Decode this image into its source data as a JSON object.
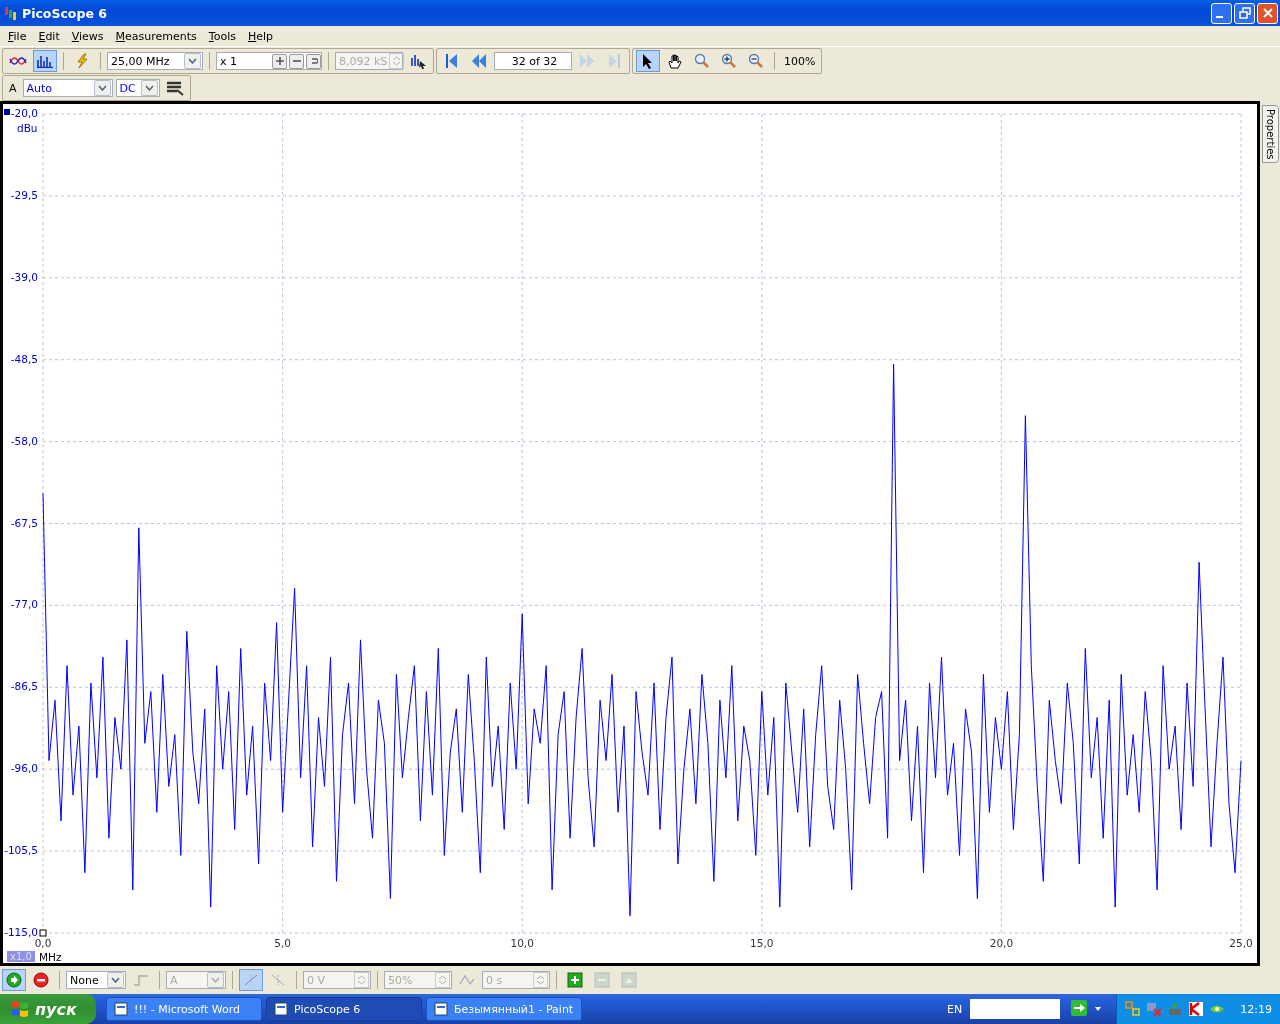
{
  "window": {
    "title": "PicoScope 6"
  },
  "menu": [
    {
      "label": "File"
    },
    {
      "label": "Edit"
    },
    {
      "label": "Views"
    },
    {
      "label": "Measurements"
    },
    {
      "label": "Tools"
    },
    {
      "label": "Help"
    }
  ],
  "toolbar": {
    "modes": [
      {
        "kind": "scope",
        "selected": false
      },
      {
        "kind": "spectrum",
        "selected": true
      }
    ],
    "timebase": "25,00 MHz",
    "zoom": "x 1",
    "samples": "8,092 kS",
    "samples_disabled": true,
    "buffer": "32 of 32",
    "tools": [
      {
        "kind": "pointer",
        "selected": true
      },
      {
        "kind": "hand",
        "selected": false
      },
      {
        "kind": "zoom",
        "selected": false
      },
      {
        "kind": "zoom-in",
        "selected": false
      },
      {
        "kind": "zoom-out",
        "selected": false
      }
    ],
    "zoom_percent": "100%"
  },
  "channel": {
    "name": "A",
    "range": "Auto",
    "coupling": "DC"
  },
  "chart": {
    "y_unit": "dBu",
    "x_unit": "MHz",
    "x_scale": "x1,0",
    "chart_data": {
      "type": "line",
      "xlim": [
        0,
        25
      ],
      "ylim": [
        -115,
        -20
      ],
      "xticks": [
        {
          "value": 0,
          "label": "0,0"
        },
        {
          "value": 5,
          "label": "5,0"
        },
        {
          "value": 10,
          "label": "10,0"
        },
        {
          "value": 15,
          "label": "15,0"
        },
        {
          "value": 20,
          "label": "20,0"
        },
        {
          "value": 25,
          "label": "25,0"
        }
      ],
      "yticks": [
        {
          "value": -20,
          "label": "-20,0"
        },
        {
          "value": -29.5,
          "label": "-29,5"
        },
        {
          "value": -39,
          "label": "-39,0"
        },
        {
          "value": -48.5,
          "label": "-48,5"
        },
        {
          "value": -58,
          "label": "-58,0"
        },
        {
          "value": -67.5,
          "label": "-67,5"
        },
        {
          "value": -77,
          "label": "-77,0"
        },
        {
          "value": -86.5,
          "label": "-86,5"
        },
        {
          "value": -96,
          "label": "-96,0"
        },
        {
          "value": -105.5,
          "label": "-105,5"
        },
        {
          "value": -115,
          "label": "-115,0"
        }
      ],
      "grid": true,
      "x": [
        0,
        0.125,
        0.25,
        0.375,
        0.5,
        0.625,
        0.75,
        0.875,
        1,
        1.125,
        1.25,
        1.375,
        1.5,
        1.625,
        1.75,
        1.875,
        2,
        2.125,
        2.25,
        2.375,
        2.5,
        2.625,
        2.75,
        2.875,
        3,
        3.125,
        3.25,
        3.375,
        3.5,
        3.625,
        3.75,
        3.875,
        4,
        4.125,
        4.25,
        4.375,
        4.5,
        4.625,
        4.75,
        4.875,
        5,
        5.125,
        5.25,
        5.375,
        5.5,
        5.625,
        5.75,
        5.875,
        6,
        6.125,
        6.25,
        6.375,
        6.5,
        6.625,
        6.75,
        6.875,
        7,
        7.125,
        7.25,
        7.375,
        7.5,
        7.625,
        7.75,
        7.875,
        8,
        8.125,
        8.25,
        8.375,
        8.5,
        8.625,
        8.75,
        8.875,
        9,
        9.125,
        9.25,
        9.375,
        9.5,
        9.625,
        9.75,
        9.875,
        10,
        10.125,
        10.25,
        10.375,
        10.5,
        10.625,
        10.75,
        10.875,
        11,
        11.125,
        11.25,
        11.375,
        11.5,
        11.625,
        11.75,
        11.875,
        12,
        12.125,
        12.25,
        12.375,
        12.5,
        12.625,
        12.75,
        12.875,
        13,
        13.125,
        13.25,
        13.375,
        13.5,
        13.625,
        13.75,
        13.875,
        14,
        14.125,
        14.25,
        14.375,
        14.5,
        14.625,
        14.75,
        14.875,
        15,
        15.125,
        15.25,
        15.375,
        15.5,
        15.625,
        15.75,
        15.875,
        16,
        16.125,
        16.25,
        16.375,
        16.5,
        16.625,
        16.75,
        16.875,
        17,
        17.125,
        17.25,
        17.375,
        17.5,
        17.625,
        17.75,
        17.875,
        18,
        18.125,
        18.25,
        18.375,
        18.5,
        18.625,
        18.75,
        18.875,
        19,
        19.125,
        19.25,
        19.375,
        19.5,
        19.625,
        19.75,
        19.875,
        20,
        20.125,
        20.25,
        20.375,
        20.5,
        20.625,
        20.75,
        20.875,
        21,
        21.125,
        21.25,
        21.375,
        21.5,
        21.625,
        21.75,
        21.875,
        22,
        22.125,
        22.25,
        22.375,
        22.5,
        22.625,
        22.75,
        22.875,
        23,
        23.125,
        23.25,
        23.375,
        23.5,
        23.625,
        23.75,
        23.875,
        24,
        24.125,
        24.25,
        24.375,
        24.5,
        24.625,
        24.75,
        24.875,
        25
      ],
      "series": [
        {
          "color": "#0000ff",
          "values": [
            -64,
            -95,
            -88,
            -102,
            -84,
            -99,
            -91,
            -108,
            -86,
            -97,
            -83,
            -104,
            -90,
            -96,
            -81,
            -110,
            -68,
            -93,
            -87,
            -101,
            -85,
            -98,
            -92,
            -106,
            -80,
            -94,
            -100,
            -89,
            -112,
            -84,
            -96,
            -87,
            -103,
            -82,
            -99,
            -91,
            -107,
            -86,
            -95,
            -79,
            -101,
            -88,
            -75,
            -97,
            -84,
            -105,
            -90,
            -98,
            -83,
            -109,
            -92,
            -86,
            -100,
            -81,
            -96,
            -104,
            -88,
            -93,
            -111,
            -85,
            -97,
            -90,
            -84,
            -102,
            -87,
            -99,
            -82,
            -106,
            -94,
            -89,
            -101,
            -85,
            -95,
            -108,
            -83,
            -98,
            -91,
            -103,
            -86,
            -96,
            -78,
            -100,
            -89,
            -93,
            -84,
            -110,
            -92,
            -87,
            -104,
            -90,
            -82,
            -97,
            -105,
            -88,
            -95,
            -85,
            -101,
            -91,
            -113,
            -87,
            -94,
            -99,
            -86,
            -103,
            -90,
            -83,
            -107,
            -96,
            -89,
            -100,
            -85,
            -93,
            -109,
            -88,
            -97,
            -84,
            -102,
            -91,
            -95,
            -106,
            -87,
            -99,
            -90,
            -112,
            -86,
            -94,
            -101,
            -89,
            -105,
            -92,
            -84,
            -98,
            -103,
            -88,
            -96,
            -110,
            -85,
            -93,
            -100,
            -90,
            -87,
            -104,
            -49,
            -95,
            -88,
            -102,
            -91,
            -108,
            -86,
            -97,
            -83,
            -99,
            -93,
            -106,
            -89,
            -94,
            -111,
            -85,
            -101,
            -90,
            -96,
            -87,
            -103,
            -92,
            -55,
            -84,
            -98,
            -109,
            -88,
            -95,
            -100,
            -86,
            -93,
            -107,
            -82,
            -97,
            -90,
            -104,
            -88,
            -112,
            -85,
            -99,
            -92,
            -101,
            -87,
            -95,
            -110,
            -84,
            -96,
            -91,
            -103,
            -86,
            -98,
            -72,
            -89,
            -105,
            -93,
            -83,
            -100,
            -108,
            -95
          ]
        }
      ]
    }
  },
  "properties_tab": "Properties",
  "trigger": {
    "mode": "None",
    "channel": "A",
    "threshold": "0 V",
    "pretrigger": "50%",
    "delay": "0 s"
  },
  "taskbar": {
    "start": "пуск",
    "tasks": [
      {
        "label": "!!! - Microsoft Word",
        "selected": false
      },
      {
        "label": "PicoScope 6",
        "selected": true
      },
      {
        "label": "Безымянный1 - Paint",
        "selected": false
      }
    ],
    "language": "EN",
    "clock": "12:19"
  }
}
